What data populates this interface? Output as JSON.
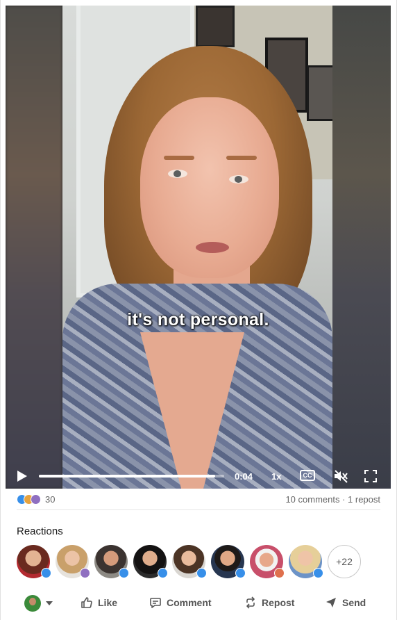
{
  "video": {
    "caption": "it's not personal.",
    "time": "0:04",
    "speed": "1x",
    "cc_label": "CC",
    "progress": 0.95
  },
  "social": {
    "reaction_count": "30",
    "comments_reposts": "10 comments · 1 repost"
  },
  "reactions": {
    "title": "Reactions",
    "more_label": "+22"
  },
  "actions": {
    "like": "Like",
    "comment": "Comment",
    "repost": "Repost",
    "send": "Send"
  },
  "colors": {
    "like_blue": "#378fe9",
    "celebrate": "#e7a33e",
    "love": "#df704d",
    "insightful": "#f5bb5c"
  }
}
